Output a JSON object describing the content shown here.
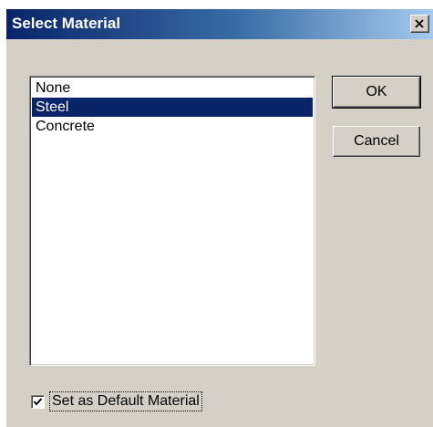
{
  "window": {
    "title": "Select Material",
    "close_icon": "close-icon"
  },
  "materials": {
    "items": [
      "None",
      "Steel",
      "Concrete"
    ],
    "selected": "Steel"
  },
  "buttons": {
    "ok_label": "OK",
    "cancel_label": "Cancel"
  },
  "default_option": {
    "label": "Set as Default Material",
    "checked": true
  },
  "colors": {
    "dialog_face": "#d4d0c8",
    "title_start": "#0a246a",
    "title_end": "#a6caf0",
    "selection": "#0a246a"
  }
}
